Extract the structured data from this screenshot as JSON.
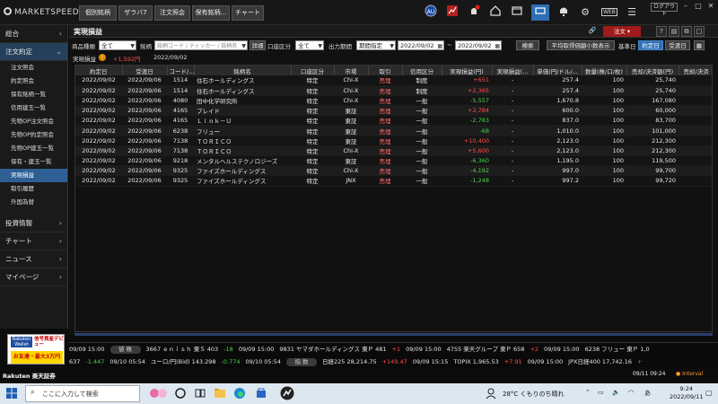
{
  "app": {
    "logo_text": "MARKETSPEED II",
    "top_tabs": [
      "個別銘柄",
      "ザラバ7",
      "注文照会",
      "保有銘柄...",
      "チャート"
    ],
    "logout_label": "ログアウト",
    "web_label": "WEB"
  },
  "sidebar": {
    "sections": [
      {
        "label": "総合",
        "open": false
      },
      {
        "label": "注文約定",
        "open": true,
        "items": [
          "注文照会",
          "約定照会",
          "保有銘柄一覧",
          "信用建玉一覧",
          "先物OP注文照会",
          "先物OP約定照会",
          "先物OP建玉一覧",
          "保有・建玉一覧",
          "実現損益",
          "取引履歴",
          "外国為替"
        ],
        "active_index": 8
      },
      {
        "label": "投資情報",
        "open": false
      },
      {
        "label": "チャート",
        "open": false
      },
      {
        "label": "ニュース",
        "open": false
      },
      {
        "label": "マイページ",
        "open": false
      }
    ],
    "ad": {
      "brand": "Rakuten Wallet",
      "headline": "信号資産デビュー",
      "promo": "お友達・最大3万円"
    }
  },
  "panel": {
    "title": "実現損益",
    "order_button": "注文",
    "filters": {
      "product_label": "商品種類",
      "product_value": "全て",
      "symbol_label": "銘柄",
      "symbol_placeholder": "銘柄コード / ティッカー / 銘柄名",
      "detail_button": "詳細",
      "account_label": "口座区分",
      "account_value": "全て",
      "period_label": "出力期間",
      "period_value": "期間指定",
      "date_from": "2022/09/02",
      "date_sep": "~",
      "date_to": "2022/09/02",
      "search_button": "検索",
      "avg_price_button": "平均取得価額小数表示",
      "base_date_label": "基準日",
      "trade_date_button": "約定日",
      "settle_date_button": "受渡日"
    },
    "summary": {
      "label": "実現損益",
      "badge": "!",
      "value": "+1,592円",
      "date": "2022/09/02"
    },
    "table": {
      "headers": [
        "約定日",
        "受渡日",
        "コード/...",
        "銘柄名",
        "口座区分",
        "市場",
        "取引",
        "信用区分",
        "実現損益(円)",
        "実現損益(...",
        "単価(円/ドル/...",
        "数量(株/口/枚)",
        "売却/決済額(円)",
        "売却/決済"
      ],
      "rows": [
        [
          "2022/09/02",
          "2022/09/06",
          "1514",
          "住石ホールディングス",
          "特定",
          "Chi-X",
          "売埋",
          "制度",
          "+651",
          "-",
          "257.4",
          "100",
          "25,740"
        ],
        [
          "2022/09/02",
          "2022/09/06",
          "1514",
          "住石ホールディングス",
          "特定",
          "Chi-X",
          "売埋",
          "制度",
          "+2,365",
          "-",
          "257.4",
          "100",
          "25,740"
        ],
        [
          "2022/09/02",
          "2022/09/06",
          "4080",
          "田中化学研究所",
          "特定",
          "Chi-X",
          "売埋",
          "一般",
          "-5,557",
          "-",
          "1,670.8",
          "100",
          "167,080"
        ],
        [
          "2022/09/02",
          "2022/09/06",
          "4165",
          "プレイド",
          "特定",
          "東証",
          "売埋",
          "一般",
          "+2,784",
          "-",
          "600.0",
          "100",
          "60,000"
        ],
        [
          "2022/09/02",
          "2022/09/06",
          "4165",
          "Ｌｉｎｋ－Ｕ",
          "特定",
          "東証",
          "売埋",
          "一般",
          "-2,783",
          "-",
          "837.0",
          "100",
          "83,700"
        ],
        [
          "2022/09/02",
          "2022/09/06",
          "6238",
          "フリュー",
          "特定",
          "東証",
          "売埋",
          "一般",
          "-68",
          "-",
          "1,010.0",
          "100",
          "101,000"
        ],
        [
          "2022/09/02",
          "2022/09/06",
          "7138",
          "ＴＯＲＩＣＯ",
          "特定",
          "東証",
          "売埋",
          "一般",
          "+10,400",
          "-",
          "2,123.0",
          "100",
          "212,300"
        ],
        [
          "2022/09/02",
          "2022/09/06",
          "7138",
          "ＴＯＲＩＣＯ",
          "特定",
          "Chi-X",
          "売埋",
          "一般",
          "+5,600",
          "-",
          "2,123.0",
          "100",
          "212,300"
        ],
        [
          "2022/09/02",
          "2022/09/06",
          "9218",
          "メンタルヘルステクノロジーズ",
          "特定",
          "東証",
          "売埋",
          "一般",
          "-6,360",
          "-",
          "1,195.0",
          "100",
          "119,500"
        ],
        [
          "2022/09/02",
          "2022/09/06",
          "9325",
          "ファイズホールディングス",
          "特定",
          "Chi-X",
          "売埋",
          "一般",
          "-4,192",
          "-",
          "997.0",
          "100",
          "99,700"
        ],
        [
          "2022/09/02",
          "2022/09/06",
          "9325",
          "ファイズホールディングス",
          "特定",
          "JNX",
          "売埋",
          "一般",
          "-1,248",
          "-",
          "997.2",
          "100",
          "99,720"
        ]
      ]
    }
  },
  "ticker": {
    "row1": [
      {
        "t": "09/09 15:00",
        "c": "w"
      },
      {
        "t": "値 株",
        "c": "pill"
      },
      {
        "t": "3667 ｅｎｉｓｈ 東Ｓ 403",
        "c": "w"
      },
      {
        "t": "-18",
        "c": "dn"
      },
      {
        "t": "09/09 15:00",
        "c": "w"
      },
      {
        "t": "9831 ヤマダホールディングス 東Ｐ 481",
        "c": "w"
      },
      {
        "t": "+1",
        "c": "up"
      },
      {
        "t": "09/09 15:00",
        "c": "w"
      },
      {
        "t": "4755 楽天グループ 東Ｐ 658",
        "c": "w"
      },
      {
        "t": "+2",
        "c": "up"
      },
      {
        "t": "09/09 15:00",
        "c": "w"
      },
      {
        "t": "6238 フリュー 東Ｐ 1,0",
        "c": "w"
      }
    ],
    "row2": [
      {
        "t": "637",
        "c": "w"
      },
      {
        "t": "-1.447",
        "c": "dn"
      },
      {
        "t": "09/10 05:54",
        "c": "w"
      },
      {
        "t": "ユーロ/円(Bid) 143.298",
        "c": "w"
      },
      {
        "t": "-0.774",
        "c": "dn"
      },
      {
        "t": "09/10 05:54",
        "c": "w"
      },
      {
        "t": "指 数",
        "c": "pill"
      },
      {
        "t": "日経225 28,214.75",
        "c": "w"
      },
      {
        "t": "+149.47",
        "c": "up"
      },
      {
        "t": "09/09 15:15",
        "c": "w"
      },
      {
        "t": "TOPIX 1,965.53",
        "c": "w"
      },
      {
        "t": "+7.91",
        "c": "up"
      },
      {
        "t": "09/09 15:00",
        "c": "w"
      },
      {
        "t": "JPX日経400 17,742.16",
        "c": "w"
      },
      {
        "t": "+",
        "c": "up"
      }
    ]
  },
  "status": {
    "brand": "Rakuten 楽天証券",
    "time": "09/11 09:24",
    "interval": "Interval"
  },
  "taskbar": {
    "search_placeholder": "ここに入力して検索",
    "weather": "28°C くもりのち晴れ",
    "clock_time": "9:24",
    "clock_date": "2022/09/11"
  }
}
